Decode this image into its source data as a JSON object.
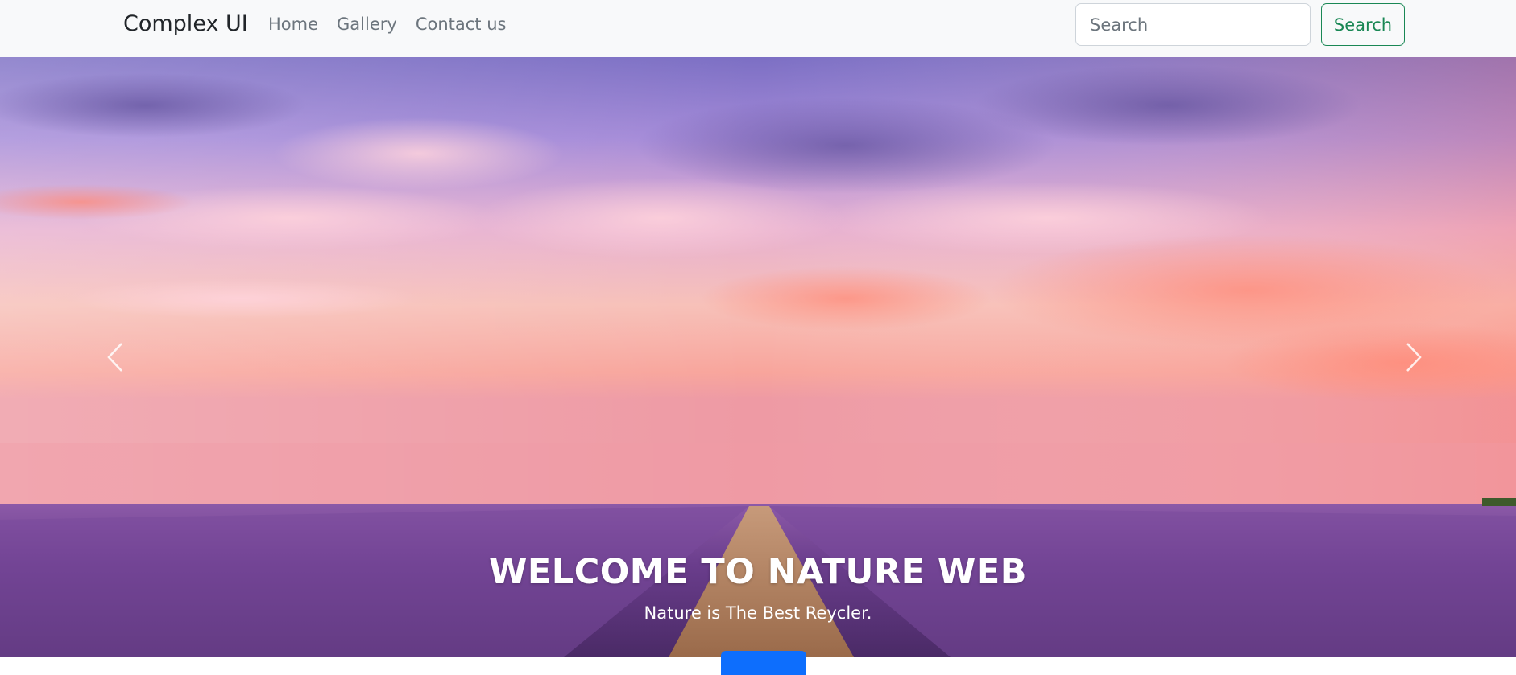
{
  "navbar": {
    "brand": "Complex UI",
    "links": [
      {
        "label": "Home"
      },
      {
        "label": "Gallery"
      },
      {
        "label": "Contact us"
      }
    ],
    "search": {
      "placeholder": "Search",
      "button_label": "Search"
    }
  },
  "carousel": {
    "caption_title": "WELCOME TO NATURE WEB",
    "caption_subtitle": "Nature is The Best Reycler.",
    "prev_icon": "chevron-left-icon",
    "next_icon": "chevron-right-icon"
  },
  "colors": {
    "navbar_bg": "#f8f9fa",
    "search_button": "#198754",
    "primary_button": "#0d6efd"
  }
}
